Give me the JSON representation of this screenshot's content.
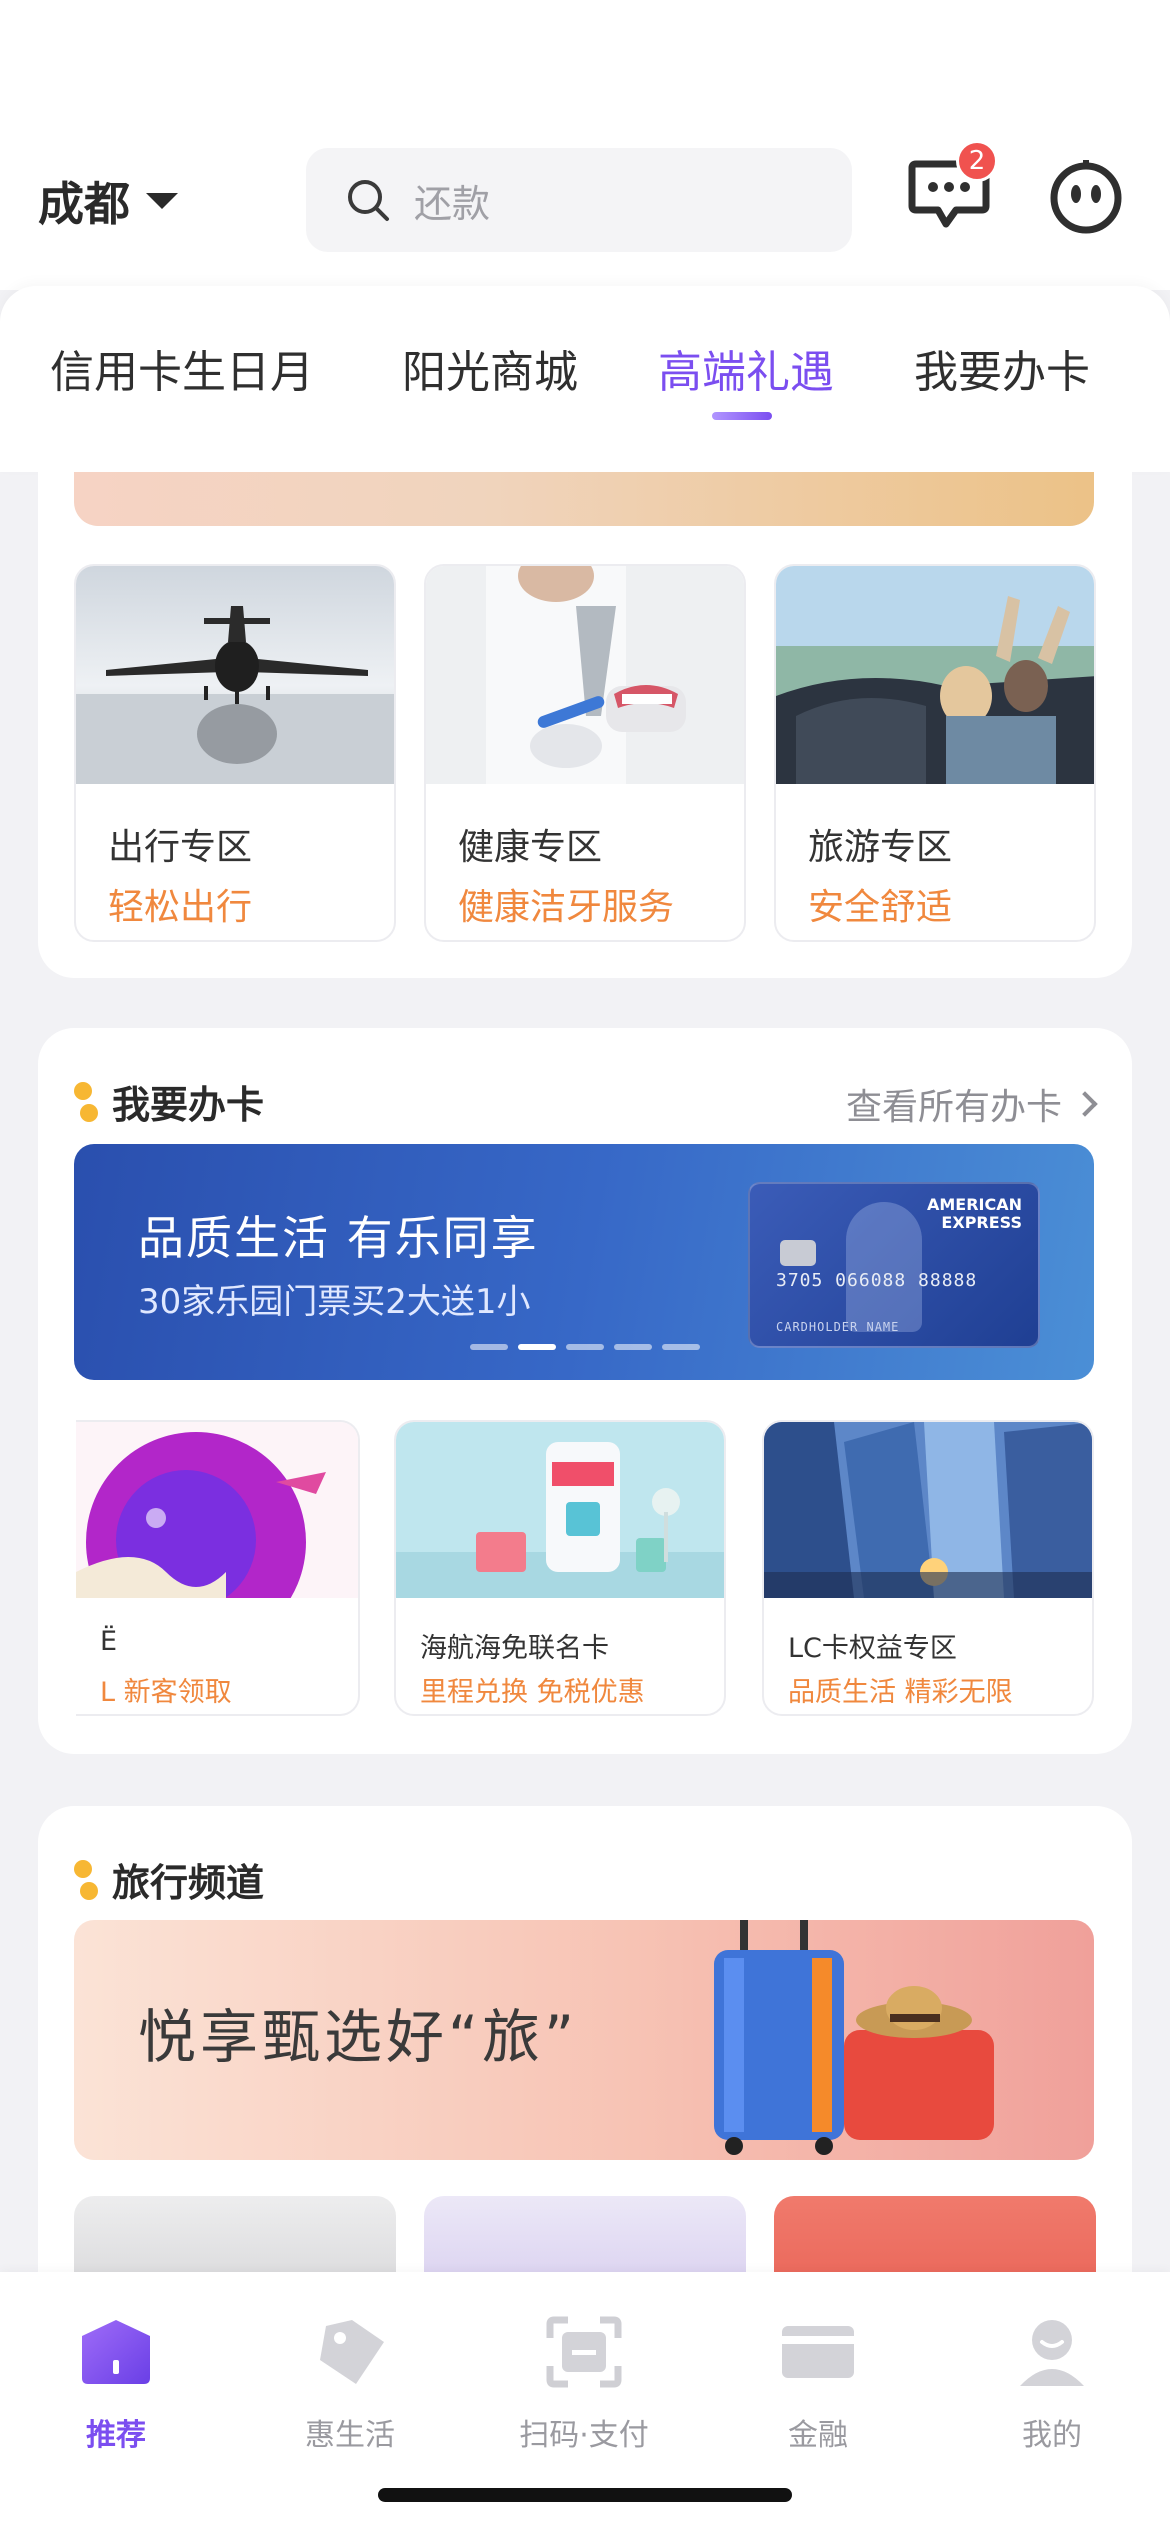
{
  "header": {
    "city": "成都",
    "search_placeholder": "还款",
    "message_badge": "2"
  },
  "tabs": [
    {
      "label": "信用卡生日月",
      "active": false
    },
    {
      "label": "阳光商城",
      "active": false
    },
    {
      "label": "高端礼遇",
      "active": true
    },
    {
      "label": "我要办卡",
      "active": false
    }
  ],
  "zones": [
    {
      "title": "出行专区",
      "subtitle": "轻松出行",
      "image": "private-jet"
    },
    {
      "title": "健康专区",
      "subtitle": "健康洁牙服务",
      "image": "dental-model"
    },
    {
      "title": "旅游专区",
      "subtitle": "安全舒适",
      "image": "convertible-car"
    }
  ],
  "apply_card": {
    "title": "我要办卡",
    "see_all": "查看所有办卡",
    "banner": {
      "headline": "品质生活 有乐同享",
      "subline": "30家乐园门票买2大送1小",
      "card_brand_line1": "AMERICAN",
      "card_brand_line2": "EXPRESS",
      "card_number": "3705 066088 88888",
      "card_holder": "CARDHOLDER NAME",
      "slide_count": 5,
      "active_slide": 1
    },
    "items": [
      {
        "title": "Ë",
        "subtitle": "L 新客领取",
        "image": "gift-ribbon"
      },
      {
        "title": "海航海免联名卡",
        "subtitle": "里程兑换 免税优惠",
        "image": "shopping-phone"
      },
      {
        "title": "LC卡权益专区",
        "subtitle": "品质生活 精彩无限",
        "image": "skyscrapers"
      }
    ]
  },
  "travel": {
    "title": "旅行频道",
    "banner_text": "悦享甄选好“旅”"
  },
  "bottom_nav": [
    {
      "label": "推荐",
      "icon": "home-icon",
      "active": true
    },
    {
      "label": "惠生活",
      "icon": "tag-icon",
      "active": false
    },
    {
      "label": "扫码·支付",
      "icon": "scan-icon",
      "active": false
    },
    {
      "label": "金融",
      "icon": "card-icon",
      "active": false
    },
    {
      "label": "我的",
      "icon": "profile-icon",
      "active": false
    }
  ],
  "colors": {
    "accent": "#7b4ef0",
    "orange": "#f0883e",
    "badge": "#f0524f"
  }
}
